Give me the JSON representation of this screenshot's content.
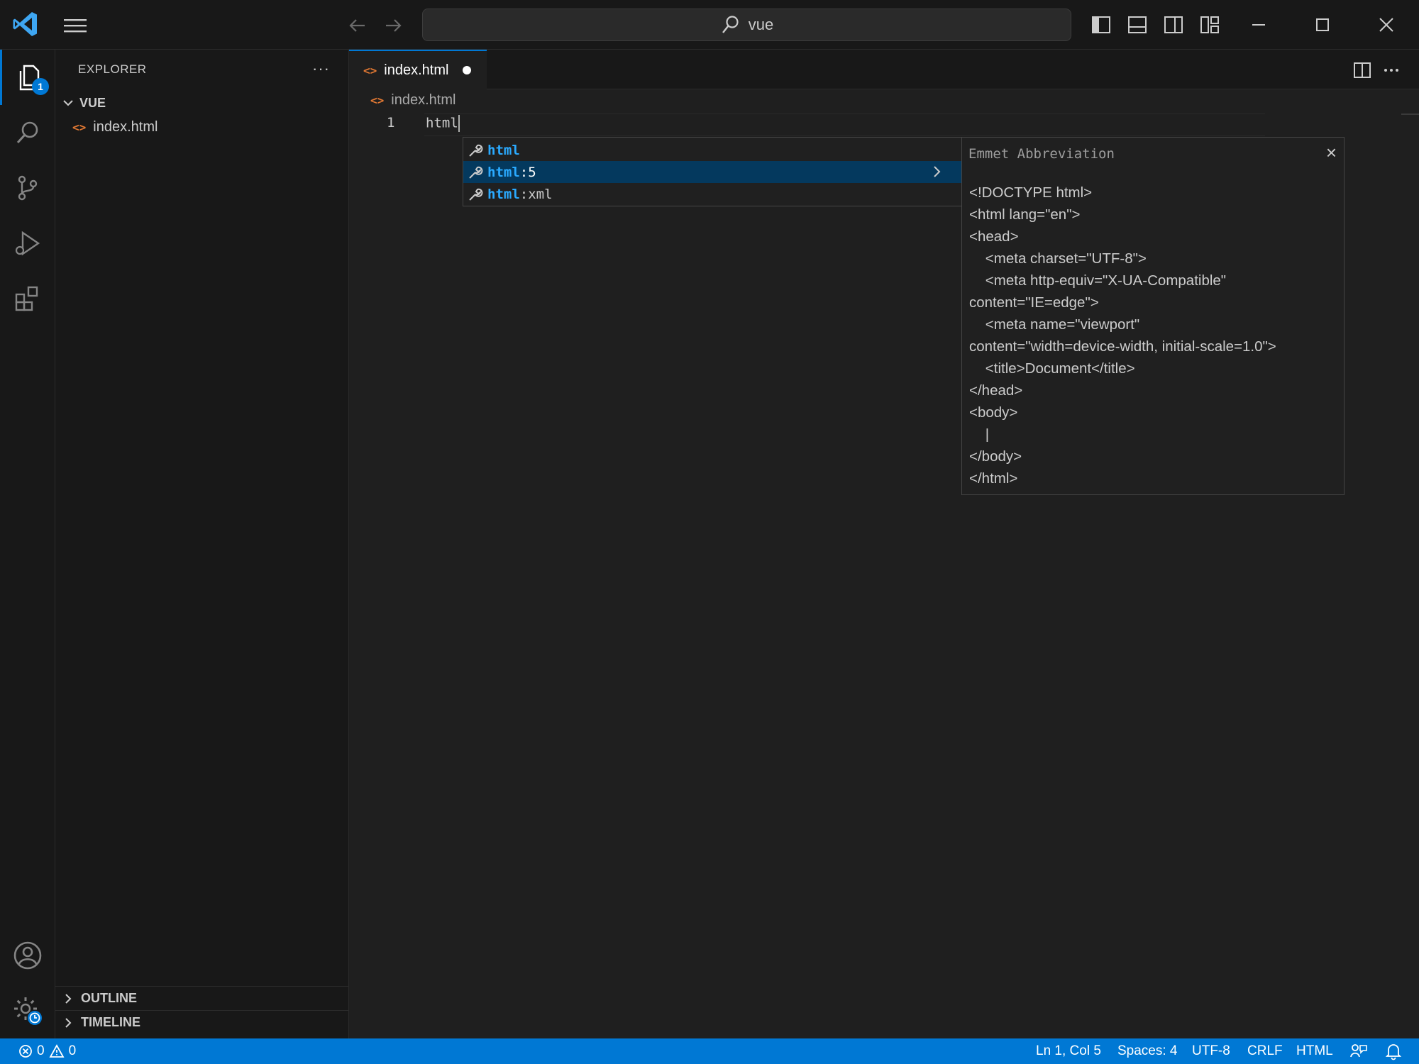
{
  "window": {
    "search_text": "vue"
  },
  "activity_bar": {
    "explorer_badge": "1"
  },
  "sidebar": {
    "title": "EXPLORER",
    "more": "···",
    "folder": "VUE",
    "file": "index.html",
    "outline": "OUTLINE",
    "timeline": "TIMELINE"
  },
  "editor": {
    "tab_label": "index.html",
    "breadcrumb": "index.html",
    "line_number": "1",
    "line_text": "html"
  },
  "suggestions": [
    {
      "match": "html",
      "rest": ""
    },
    {
      "match": "html",
      "rest": ":5"
    },
    {
      "match": "html",
      "rest": ":xml"
    }
  ],
  "detail": {
    "heading": "Emmet Abbreviation",
    "close": "×",
    "preview": "<!DOCTYPE html>\n<html lang=\"en\">\n<head>\n\t<meta charset=\"UTF-8\">\n\t<meta http-equiv=\"X-UA-Compatible\"\ncontent=\"IE=edge\">\n\t<meta name=\"viewport\"\ncontent=\"width=device-width, initial-scale=1.0\">\n\t<title>Document</title>\n</head>\n<body>\n\t|\n</body>\n</html>"
  },
  "statusbar": {
    "errors": "0",
    "warnings": "0",
    "position": "Ln 1, Col 5",
    "spaces": "Spaces: 4",
    "encoding": "UTF-8",
    "eol": "CRLF",
    "language": "HTML"
  },
  "colors": {
    "accent": "#0078d4",
    "match_highlight": "#2aaaff",
    "selected_row": "#04395e",
    "html_icon": "#e37933"
  }
}
